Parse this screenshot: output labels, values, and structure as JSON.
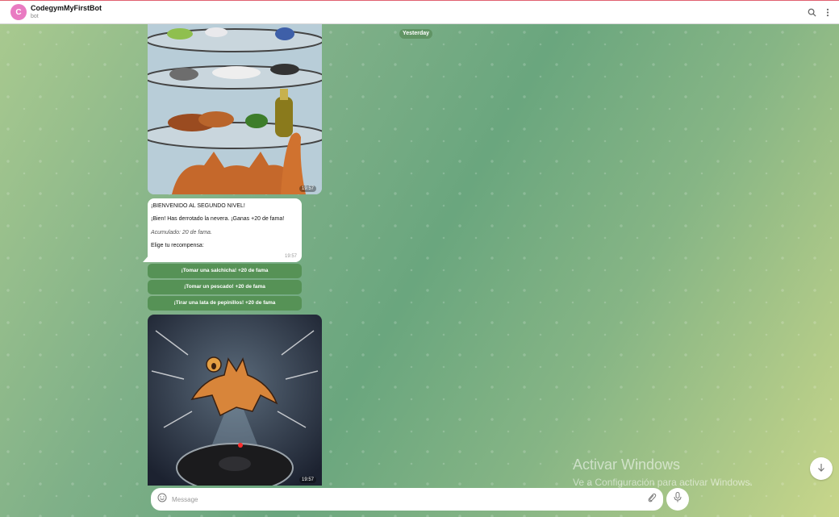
{
  "header": {
    "avatar_letter": "C",
    "title": "CodegymMyFirstBot",
    "subtitle": "bot",
    "search_icon": "search-icon",
    "menu_icon": "more-vertical-icon"
  },
  "colors": {
    "avatar": "#e97bc2",
    "keyboard_button": "#569256",
    "bubble": "#ffffff"
  },
  "chat": {
    "date_separator": "Yesterday",
    "photo1_time": "19:57",
    "photo2_time": "19:57",
    "message": {
      "line1": "¡BIENVENIDO AL SEGUNDO NIVEL!",
      "line2": "¡Bien! Has derrotado la nevera. ¡Ganas +20 de fama!",
      "line3": "Acumulado: 20 de fama.",
      "line4": "Elige tu recompensa:",
      "time": "19:57"
    },
    "keyboard": [
      "¡Tomar una salchicha! +20 de fama",
      "¡Tomar un pescado! +20 de fama",
      "¡Tirar una lata de pepinillos! +20 de fama"
    ]
  },
  "composer": {
    "placeholder": "Message",
    "emoji_icon": "smile-icon",
    "attach_icon": "paperclip-icon",
    "mic_icon": "microphone-icon"
  },
  "scroll_icon": "arrow-down-icon",
  "watermark": {
    "title": "Activar Windows",
    "subtitle": "Ve a Configuración para activar Windows."
  }
}
